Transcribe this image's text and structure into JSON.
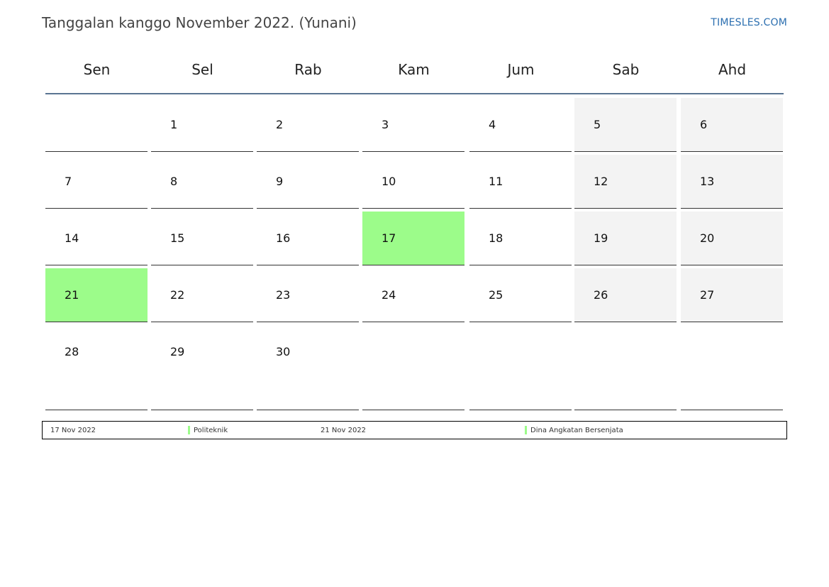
{
  "header": {
    "title": "Tanggalan kanggo November 2022. (Yunani)",
    "brand": "TIMESLES.COM"
  },
  "calendar": {
    "weekdays": [
      "Sen",
      "Sel",
      "Rab",
      "Kam",
      "Jum",
      "Sab",
      "Ahd"
    ],
    "weeks": [
      [
        "",
        "1",
        "2",
        "3",
        "4",
        "5",
        "6"
      ],
      [
        "7",
        "8",
        "9",
        "10",
        "11",
        "12",
        "13"
      ],
      [
        "14",
        "15",
        "16",
        "17",
        "18",
        "19",
        "20"
      ],
      [
        "21",
        "22",
        "23",
        "24",
        "25",
        "26",
        "27"
      ],
      [
        "28",
        "29",
        "30",
        "",
        "",
        "",
        ""
      ]
    ],
    "holidays": [
      "17",
      "21"
    ]
  },
  "colors": {
    "holiday": "#9cfc8a",
    "weekend": "#f3f3f3",
    "header_line": "#5a7592",
    "brand": "#2c6fb0"
  },
  "legend": [
    {
      "date": "17 Nov 2022",
      "name": "Politeknik"
    },
    {
      "date": "21 Nov 2022",
      "name": "Dina Angkatan Bersenjata"
    }
  ]
}
